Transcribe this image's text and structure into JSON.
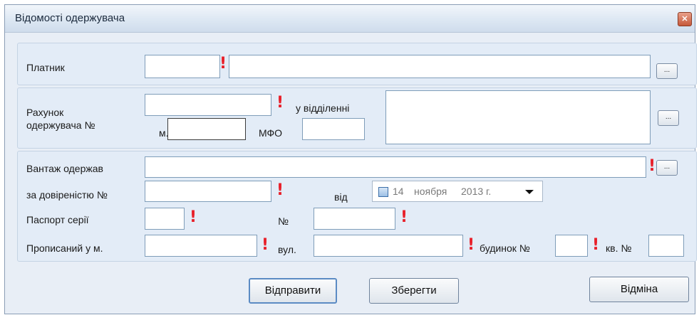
{
  "window": {
    "title": "Відомості одержувача",
    "close_icon": "close-icon"
  },
  "payer": {
    "label": "Платник",
    "code_value": "",
    "name_value": "",
    "browse_label": "..."
  },
  "account": {
    "label_line1": "Рахунок",
    "label_line2": "одержувача №",
    "number_value": "",
    "branch_label": "у відділенні",
    "branch_value": "",
    "city_label": "м.",
    "city_value": "",
    "mfo_label": "МФО",
    "mfo_value": "",
    "browse_label": "..."
  },
  "cargo": {
    "received_by_label": "Вантаж одержав",
    "received_by_value": "",
    "browse_label": "...",
    "proxy_label": "за довіреністю №",
    "proxy_value": "",
    "from_label": "від",
    "date_day": "14",
    "date_month": "ноября",
    "date_year": "2013 г.",
    "passport_series_label": "Паспорт серії",
    "passport_series_value": "",
    "passport_number_label": "№",
    "passport_number_value": "",
    "registered_label": "Прописаний у м.",
    "registered_value": "",
    "street_label": "вул.",
    "street_value": "",
    "house_label": "будинок №",
    "house_value": "",
    "apartment_label": "кв. №",
    "apartment_value": ""
  },
  "required_mark": "!",
  "buttons": {
    "send": "Відправити",
    "save": "Зберегти",
    "cancel": "Відміна"
  }
}
